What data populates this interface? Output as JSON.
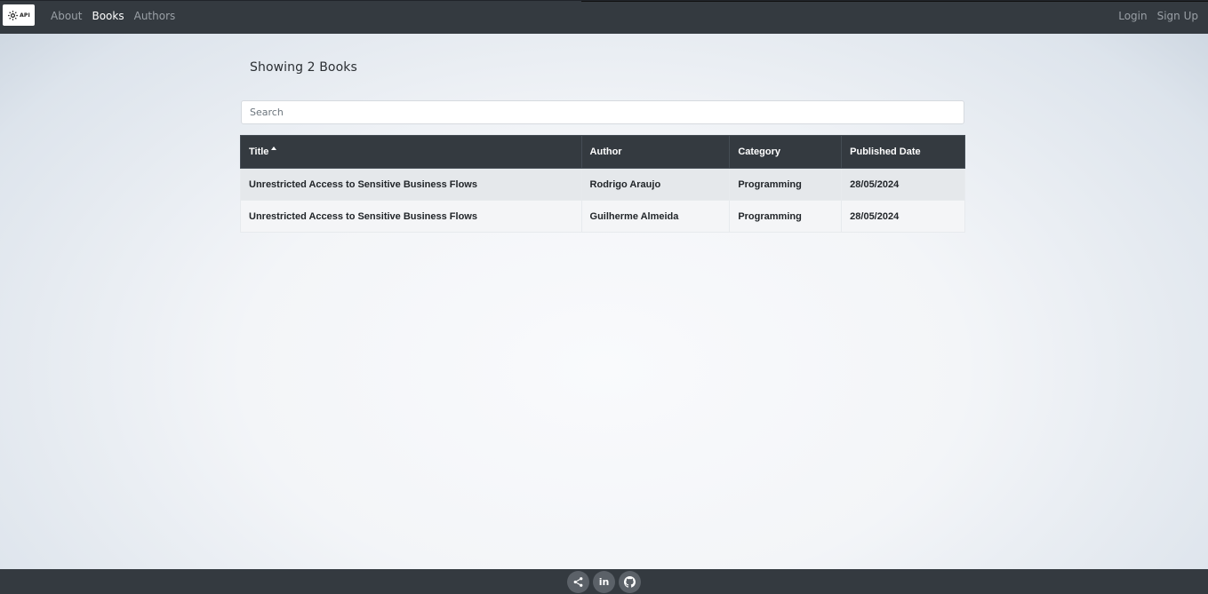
{
  "navbar": {
    "brand_text": "API",
    "links": [
      {
        "label": "About",
        "active": false
      },
      {
        "label": "Books",
        "active": true
      },
      {
        "label": "Authors",
        "active": false
      }
    ],
    "auth": {
      "login": "Login",
      "signup": "Sign Up"
    }
  },
  "main": {
    "heading": "Showing 2 Books",
    "search": {
      "placeholder": "Search",
      "value": ""
    },
    "table": {
      "columns": [
        "Title",
        "Author",
        "Category",
        "Published Date"
      ],
      "sorted_column": "Title",
      "sort_direction": "ascending",
      "rows": [
        [
          "Unrestricted Access to Sensitive Business Flows",
          "Rodrigo Araujo",
          "Programming",
          "28/05/2024"
        ],
        [
          "Unrestricted Access to Sensitive Business Flows",
          "Guilherme Almeida",
          "Programming",
          "28/05/2024"
        ]
      ]
    }
  },
  "footer": {
    "icons": [
      "share-icon",
      "linkedin-icon",
      "github-icon"
    ],
    "linkedin_text": "in"
  },
  "colors": {
    "navbar_bg": "#343a40",
    "nav_link": "#9aa0a6",
    "nav_link_active": "#ffffff",
    "table_header_bg": "#343a40",
    "row_odd_bg": "#e5e8eb",
    "row_even_bg": "#f4f5f7"
  }
}
